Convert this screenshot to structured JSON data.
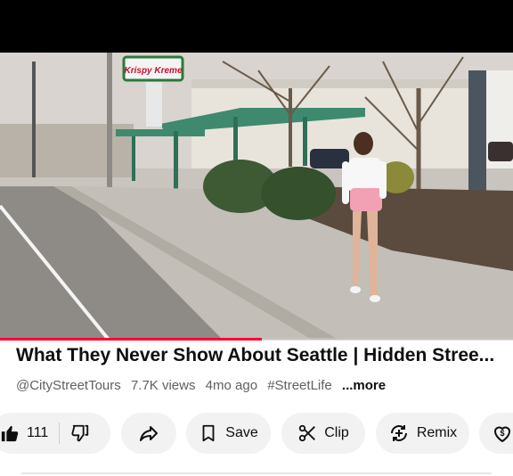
{
  "video": {
    "sign_text": "Krispy Kreme",
    "progress_fraction": 0.51
  },
  "details": {
    "title": "What They Never Show About Seattle | Hidden Stree...",
    "channel": "@CityStreetTours",
    "views": "7.7K views",
    "age": "4mo ago",
    "hashtag": "#StreetLife",
    "more_label": "...more"
  },
  "actions": {
    "like_count": "111",
    "save_label": "Save",
    "clip_label": "Clip",
    "remix_label": "Remix"
  },
  "icons": {
    "like": "thumbs-up-icon",
    "dislike": "thumbs-down-icon",
    "share": "share-arrow-icon",
    "save": "bookmark-icon",
    "clip": "scissors-icon",
    "remix": "remix-icon",
    "thanks": "heart-dollar-icon"
  },
  "colors": {
    "progress": "#ff0033",
    "pill_bg": "#f2f2f2",
    "meta_text": "#606060"
  }
}
